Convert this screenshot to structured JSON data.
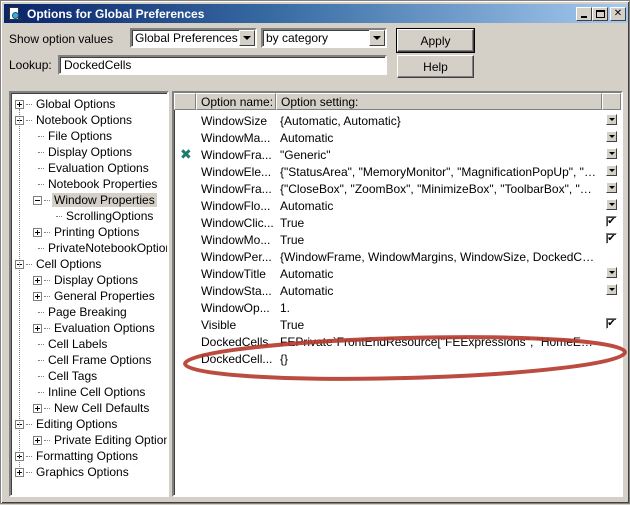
{
  "window": {
    "title": "Options for Global Preferences",
    "controls": {
      "minimize": "minimize",
      "maximize": "maximize",
      "close": "close"
    }
  },
  "toolbar": {
    "show_label": "Show option values",
    "scope_value": "Global Preferences",
    "view_value": "by category",
    "lookup_label": "Lookup:",
    "lookup_value": "DockedCells",
    "apply_label": "Apply",
    "help_label": "Help"
  },
  "tree": {
    "items": [
      {
        "label": "Global Options",
        "level": 0,
        "expander": "plus"
      },
      {
        "label": "Notebook Options",
        "level": 0,
        "expander": "minus"
      },
      {
        "label": "File Options",
        "level": 1,
        "expander": "none"
      },
      {
        "label": "Display Options",
        "level": 1,
        "expander": "none"
      },
      {
        "label": "Evaluation Options",
        "level": 1,
        "expander": "none"
      },
      {
        "label": "Notebook Properties",
        "level": 1,
        "expander": "none"
      },
      {
        "label": "Window Properties",
        "level": 1,
        "expander": "minus",
        "selected": true
      },
      {
        "label": "ScrollingOptions",
        "level": 2,
        "expander": "none"
      },
      {
        "label": "Printing Options",
        "level": 1,
        "expander": "plus"
      },
      {
        "label": "PrivateNotebookOptions",
        "level": 1,
        "expander": "none"
      },
      {
        "label": "Cell Options",
        "level": 0,
        "expander": "minus"
      },
      {
        "label": "Display Options",
        "level": 1,
        "expander": "plus"
      },
      {
        "label": "General Properties",
        "level": 1,
        "expander": "plus"
      },
      {
        "label": "Page Breaking",
        "level": 1,
        "expander": "none"
      },
      {
        "label": "Evaluation Options",
        "level": 1,
        "expander": "plus"
      },
      {
        "label": "Cell Labels",
        "level": 1,
        "expander": "none"
      },
      {
        "label": "Cell Frame Options",
        "level": 1,
        "expander": "none"
      },
      {
        "label": "Cell Tags",
        "level": 1,
        "expander": "none"
      },
      {
        "label": "Inline Cell Options",
        "level": 1,
        "expander": "none"
      },
      {
        "label": "New Cell Defaults",
        "level": 1,
        "expander": "plus"
      },
      {
        "label": "Editing Options",
        "level": 0,
        "expander": "minus"
      },
      {
        "label": "Private Editing Options",
        "level": 1,
        "expander": "plus"
      },
      {
        "label": "Formatting Options",
        "level": 0,
        "expander": "plus"
      },
      {
        "label": "Graphics Options",
        "level": 0,
        "expander": "plus"
      }
    ]
  },
  "grid": {
    "headers": {
      "mark": "",
      "name": "Option name:",
      "setting": "Option setting:",
      "control": ""
    },
    "rows": [
      {
        "name": "WindowSize",
        "setting": "{Automatic, Automatic}",
        "control": "dropdown",
        "mark": ""
      },
      {
        "name": "WindowMa...",
        "setting": "Automatic",
        "control": "dropdown",
        "mark": ""
      },
      {
        "name": "WindowFra...",
        "setting": "\"Generic\"",
        "control": "dropdown",
        "mark": "modified-x"
      },
      {
        "name": "WindowEle...",
        "setting": "{\"StatusArea\", \"MemoryMonitor\", \"MagnificationPopUp\", \"Horizo...",
        "control": "dropdown",
        "mark": ""
      },
      {
        "name": "WindowFra...",
        "setting": "{\"CloseBox\", \"ZoomBox\", \"MinimizeBox\", \"ToolbarBox\", \"Docume...",
        "control": "dropdown",
        "mark": ""
      },
      {
        "name": "WindowFlo...",
        "setting": "Automatic",
        "control": "dropdown",
        "mark": ""
      },
      {
        "name": "WindowClic...",
        "setting": "True",
        "control": "checkbox",
        "checked": true,
        "mark": ""
      },
      {
        "name": "WindowMo...",
        "setting": "True",
        "control": "checkbox",
        "checked": true,
        "mark": ""
      },
      {
        "name": "WindowPer...",
        "setting": "{WindowFrame, WindowMargins, WindowSize, DockedCells, Ma...",
        "control": "none",
        "mark": ""
      },
      {
        "name": "WindowTitle",
        "setting": "Automatic",
        "control": "dropdown",
        "mark": ""
      },
      {
        "name": "WindowSta...",
        "setting": "Automatic",
        "control": "dropdown",
        "mark": ""
      },
      {
        "name": "WindowOp...",
        "setting": "1.",
        "control": "none",
        "mark": ""
      },
      {
        "name": "Visible",
        "setting": "True",
        "control": "checkbox",
        "checked": true,
        "mark": ""
      },
      {
        "name": "DockedCells",
        "setting": "FEPrivate`FrontEndResource[\"FEExpressions\", \"HomeEditionBar\"]",
        "control": "none",
        "mark": ""
      },
      {
        "name": "DockedCell...",
        "setting": "{}",
        "control": "none",
        "mark": ""
      }
    ]
  },
  "annotation": {
    "shape": "ellipse",
    "color": "#b5382a",
    "highlights": "DockedCells"
  },
  "colors": {
    "face": "#d4d0c8",
    "title_start": "#0a246a",
    "title_end": "#a6caf0",
    "modified_mark": "#1e7a6e"
  }
}
